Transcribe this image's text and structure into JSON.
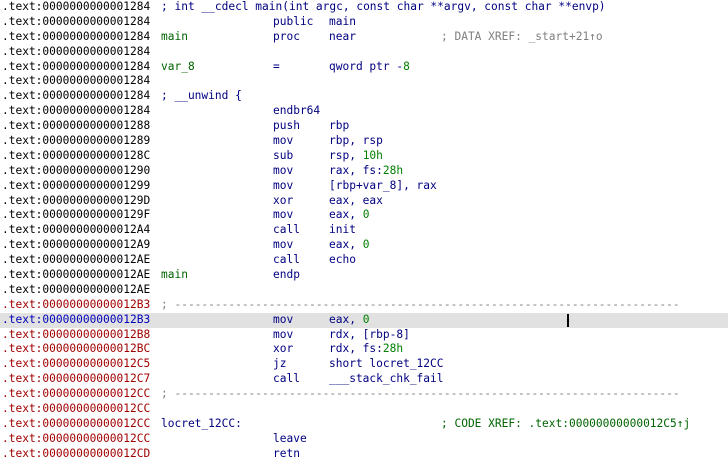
{
  "listing": {
    "rows": [
      {
        "seg": ".text:",
        "hex": "0000000000001284",
        "addr_color": "default",
        "comment": "; int __cdecl main(int argc, const char **argv, const char **envp)"
      },
      {
        "seg": ".text:",
        "hex": "0000000000001284",
        "addr_color": "default",
        "mnemonic": "public",
        "operand": "main"
      },
      {
        "seg": ".text:",
        "hex": "0000000000001284",
        "addr_color": "default",
        "label": "main",
        "mnemonic": "proc",
        "operand": "near",
        "xref": "; DATA XREF: _start+21↑o",
        "xref_color": "gray"
      },
      {
        "seg": ".text:",
        "hex": "0000000000001284",
        "addr_color": "default"
      },
      {
        "seg": ".text:",
        "hex": "0000000000001284",
        "addr_color": "default",
        "label": "var_8",
        "mnemonic": "=",
        "operand": "qword ptr -8"
      },
      {
        "seg": ".text:",
        "hex": "0000000000001284",
        "addr_color": "default"
      },
      {
        "seg": ".text:",
        "hex": "0000000000001284",
        "addr_color": "default",
        "comment": "; __unwind {"
      },
      {
        "seg": ".text:",
        "hex": "0000000000001284",
        "addr_color": "default",
        "mnemonic": "endbr64"
      },
      {
        "seg": ".text:",
        "hex": "0000000000001288",
        "addr_color": "default",
        "mnemonic": "push",
        "operand": "rbp"
      },
      {
        "seg": ".text:",
        "hex": "0000000000001289",
        "addr_color": "default",
        "mnemonic": "mov",
        "operand": "rbp, rsp"
      },
      {
        "seg": ".text:",
        "hex": "000000000000128C",
        "addr_color": "default",
        "mnemonic": "sub",
        "operand": "rsp, 10h"
      },
      {
        "seg": ".text:",
        "hex": "0000000000001290",
        "addr_color": "default",
        "mnemonic": "mov",
        "operand": "rax, fs:28h"
      },
      {
        "seg": ".text:",
        "hex": "0000000000001299",
        "addr_color": "default",
        "mnemonic": "mov",
        "operand": "[rbp+var_8], rax"
      },
      {
        "seg": ".text:",
        "hex": "000000000000129D",
        "addr_color": "default",
        "mnemonic": "xor",
        "operand": "eax, eax"
      },
      {
        "seg": ".text:",
        "hex": "000000000000129F",
        "addr_color": "default",
        "mnemonic": "mov",
        "operand": "eax, 0"
      },
      {
        "seg": ".text:",
        "hex": "00000000000012A4",
        "addr_color": "default",
        "mnemonic": "call",
        "operand": "init"
      },
      {
        "seg": ".text:",
        "hex": "00000000000012A9",
        "addr_color": "default",
        "mnemonic": "mov",
        "operand": "eax, 0"
      },
      {
        "seg": ".text:",
        "hex": "00000000000012AE",
        "addr_color": "default",
        "mnemonic": "call",
        "operand": "echo"
      },
      {
        "seg": ".text:",
        "hex": "00000000000012AE",
        "addr_color": "default",
        "label": "main",
        "mnemonic": "endp"
      },
      {
        "seg": ".text:",
        "hex": "00000000000012AE",
        "addr_color": "default"
      },
      {
        "seg": ".text:",
        "hex": "00000000000012B3",
        "addr_color": "red",
        "separator": "; ---------------------------------------------------------------------------"
      },
      {
        "seg": ".text:",
        "hex": "00000000000012B3",
        "addr_color": "blue",
        "mnemonic": "mov",
        "operand": "eax, 0",
        "highlight": true,
        "cursor": true
      },
      {
        "seg": ".text:",
        "hex": "00000000000012B8",
        "addr_color": "red",
        "mnemonic": "mov",
        "operand": "rdx, [rbp-8]"
      },
      {
        "seg": ".text:",
        "hex": "00000000000012BC",
        "addr_color": "red",
        "mnemonic": "xor",
        "operand": "rdx, fs:28h"
      },
      {
        "seg": ".text:",
        "hex": "00000000000012C5",
        "addr_color": "red",
        "mnemonic": "jz",
        "operand": "short locret_12CC"
      },
      {
        "seg": ".text:",
        "hex": "00000000000012C7",
        "addr_color": "red",
        "mnemonic": "call",
        "operand": "___stack_chk_fail"
      },
      {
        "seg": ".text:",
        "hex": "00000000000012CC",
        "addr_color": "red",
        "separator": "; ---------------------------------------------------------------------------"
      },
      {
        "seg": ".text:",
        "hex": "00000000000012CC",
        "addr_color": "red"
      },
      {
        "seg": ".text:",
        "hex": "00000000000012CC",
        "addr_color": "red",
        "inline_label": "locret_12CC:",
        "xref": "; CODE XREF: .text:00000000000012C5↑j",
        "xref_color": "green"
      },
      {
        "seg": ".text:",
        "hex": "00000000000012CC",
        "addr_color": "red",
        "mnemonic": "leave"
      },
      {
        "seg": ".text:",
        "hex": "00000000000012CD",
        "addr_color": "red",
        "mnemonic": "retn"
      }
    ]
  },
  "colors": {
    "background": "#ffffff",
    "highlight_row": "#e1e1e1",
    "address_red": "#a00000",
    "address_blue": "#0000b8",
    "instruction": "#000080",
    "label": "#006400",
    "number": "#008000",
    "xref_gray": "#808080",
    "separator": "#808080"
  }
}
